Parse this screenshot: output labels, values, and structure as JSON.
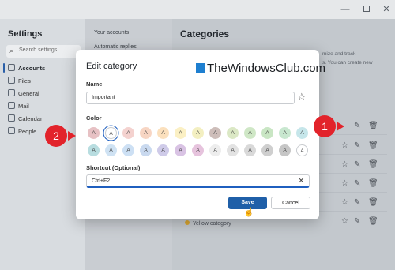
{
  "window": {
    "min_icon": "—",
    "max_icon": "max",
    "close_icon": "✕"
  },
  "nav": {
    "title": "Settings",
    "search_placeholder": "Search settings",
    "items": [
      {
        "label": "Accounts",
        "icon": "person-icon"
      },
      {
        "label": "Files",
        "icon": "file-icon"
      },
      {
        "label": "General",
        "icon": "gear-icon"
      },
      {
        "label": "Mail",
        "icon": "mail-icon"
      },
      {
        "label": "Calendar",
        "icon": "calendar-icon"
      },
      {
        "label": "People",
        "icon": "people-icon"
      }
    ]
  },
  "mid": {
    "items": [
      "Your accounts",
      "Automatic replies"
    ]
  },
  "categories": {
    "title": "Categories",
    "desc_lines": [
      "mize and track",
      "s. You can create new"
    ],
    "yellow_category": "Yellow category"
  },
  "dialog": {
    "title": "Edit category",
    "name_label": "Name",
    "name_value": "Important",
    "color_label": "Color",
    "swatch_letter": "A",
    "swatch_colors_row1": [
      "#e7c1c4",
      "#ffffff",
      "#f4d2cf",
      "#f7d5c3",
      "#fbe0bd",
      "#fbf0c4",
      "#f3efc1",
      "#cdbdb9",
      "#dbe8c5",
      "#cfe7c6",
      "#c9e6c4",
      "#c8e7cf",
      "#c6e6ea"
    ],
    "swatch_colors_row2": [
      "#b8dde0",
      "#cfe2f3",
      "#cde0f4",
      "#c9d9ef",
      "#cfcbe9",
      "#d9c3e4",
      "#e6c3dd",
      "#ededed",
      "#e3e3e3",
      "#d9d9d9",
      "#cfcfcf",
      "#c6c6c6",
      "#ffffff"
    ],
    "shortcut_label": "Shortcut (Optional)",
    "shortcut_value": "Ctrl+F2",
    "save_label": "Save",
    "cancel_label": "Cancel"
  },
  "watermark": "TheWindowsClub.com",
  "callouts": {
    "one": "1",
    "two": "2"
  }
}
